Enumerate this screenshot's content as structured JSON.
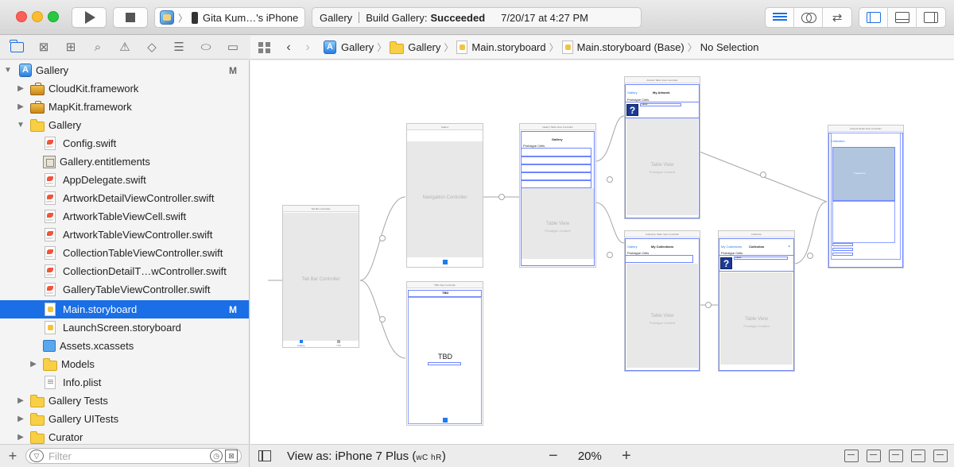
{
  "toolbar": {
    "scheme_target": "Gita Kum…'s iPhone",
    "activity_project": "Gallery",
    "activity_status_prefix": "Build Gallery:",
    "activity_status": "Succeeded",
    "activity_time": "7/20/17 at 4:27 PM"
  },
  "navigator": {
    "items": [
      {
        "label": "Gallery",
        "badge": "M"
      },
      {
        "label": "CloudKit.framework"
      },
      {
        "label": "MapKit.framework"
      },
      {
        "label": "Gallery"
      },
      {
        "label": "Config.swift"
      },
      {
        "label": "Gallery.entitlements"
      },
      {
        "label": "AppDelegate.swift"
      },
      {
        "label": "ArtworkDetailViewController.swift"
      },
      {
        "label": "ArtworkTableViewCell.swift"
      },
      {
        "label": "ArtworkTableViewController.swift"
      },
      {
        "label": "CollectionTableViewController.swift"
      },
      {
        "label": "CollectionDetailT…wController.swift"
      },
      {
        "label": "GalleryTableViewController.swift"
      },
      {
        "label": "Main.storyboard",
        "badge": "M",
        "selected": true
      },
      {
        "label": "LaunchScreen.storyboard"
      },
      {
        "label": "Assets.xcassets"
      },
      {
        "label": "Models"
      },
      {
        "label": "Info.plist"
      },
      {
        "label": "Gallery Tests"
      },
      {
        "label": "Gallery UITests"
      },
      {
        "label": "Curator"
      }
    ],
    "filter_placeholder": "Filter"
  },
  "jumpbar": {
    "crumbs": [
      "Gallery",
      "Gallery",
      "Main.storyboard",
      "Main.storyboard (Base)",
      "No Selection"
    ]
  },
  "canvas": {
    "scenes": {
      "tab_bar": {
        "title": "Tab Bar Controller",
        "label": "Tab Bar Controller",
        "tab1": "Gallery",
        "tab2": "TBD"
      },
      "nav": {
        "title": "Gallery",
        "label": "Navigation Controller"
      },
      "tbd": {
        "title": "TBD View Controller",
        "nav_title": "TBD",
        "center": "TBD"
      },
      "gallery_table": {
        "title": "Gallery Table View Controller",
        "nav_title": "Gallery",
        "cells_label": "Prototype Cells",
        "table_label": "Table View",
        "table_sub": "Prototype Content"
      },
      "artwork_table": {
        "title": "Artwork Table View Controller",
        "back": "Gallery",
        "nav_title": "My Artwork",
        "cells_label": "Prototype Cells",
        "cell_label": "Label",
        "table_label": "Table View",
        "table_sub": "Prototype Content"
      },
      "collection_table": {
        "title": "Collection Table View Controller",
        "back": "Gallery",
        "nav_title": "My Collections",
        "cells_label": "Prototype Cells",
        "table_label": "Table View",
        "table_sub": "Prototype Content"
      },
      "collection": {
        "title": "Collection",
        "back": "My Collections",
        "nav_title": "Collection",
        "cells_label": "Prototype Cells",
        "cell_label": "Label",
        "table_label": "Table View",
        "table_sub": "Prototype Content"
      },
      "artwork_detail": {
        "title": "Artwork Detail View Controller",
        "back": "Collection",
        "image_label": "ImageView"
      }
    }
  },
  "bottombar": {
    "view_as_prefix": "View as: iPhone 7 Plus (",
    "size_class": "wC hR",
    "view_as_suffix": ")",
    "zoom": "20%"
  }
}
